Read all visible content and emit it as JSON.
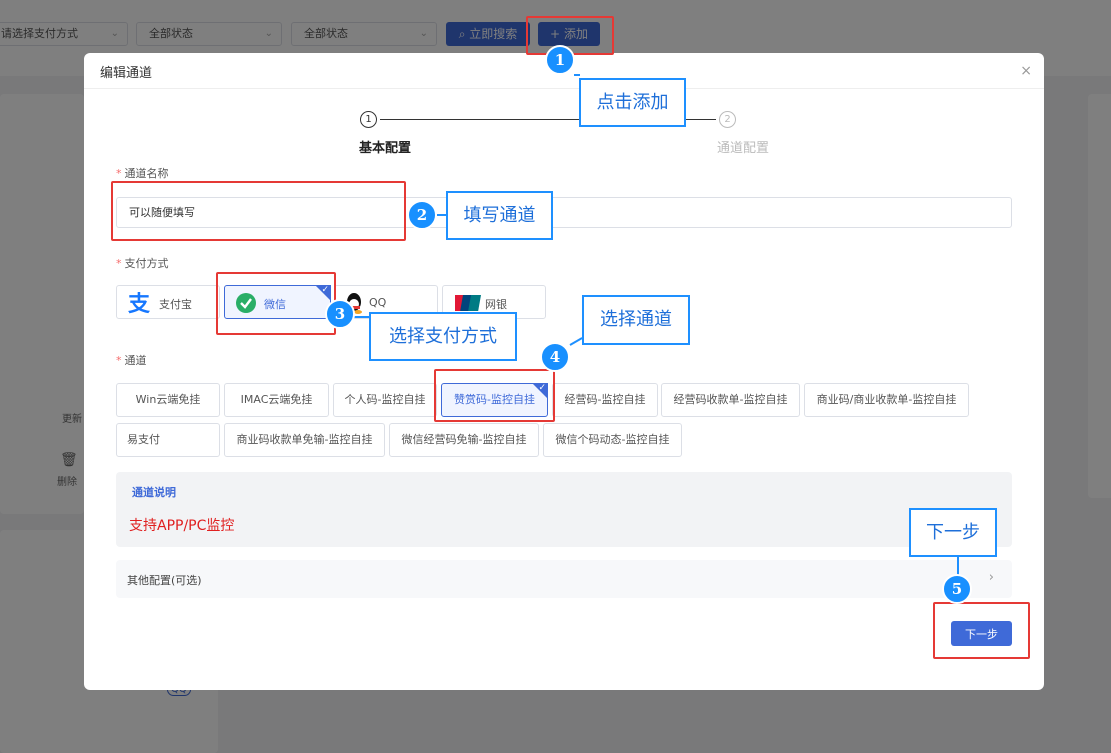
{
  "background": {
    "filters": [
      {
        "value": "请选择支付方式"
      },
      {
        "value": "全部状态"
      },
      {
        "value": "全部状态"
      }
    ],
    "search_label": "立即搜索",
    "add_label": "添加",
    "update_label": "更新",
    "delete_label": "删除",
    "qq_badge": "QQ"
  },
  "modal": {
    "title": "编辑通道",
    "close_icon": "×",
    "steps": [
      {
        "num": "1",
        "label": "基本配置"
      },
      {
        "num": "2",
        "label": "通道配置"
      }
    ],
    "name_field": {
      "required": "*",
      "label": "通道名称",
      "value": "可以随便填写"
    },
    "payment": {
      "required": "*",
      "label": "支付方式",
      "options": [
        {
          "label": "支付宝",
          "icon": "alipay-icon"
        },
        {
          "label": "微信",
          "icon": "wechat-icon",
          "selected": true
        },
        {
          "label": "QQ",
          "icon": "qq-icon"
        },
        {
          "label": "网银",
          "icon": "unionpay-icon"
        }
      ]
    },
    "channel": {
      "required": "*",
      "label": "通道",
      "options": [
        {
          "label": "Win云端免挂"
        },
        {
          "label": "IMAC云端免挂"
        },
        {
          "label": "个人码-监控自挂"
        },
        {
          "label": "赞赏码-监控自挂",
          "selected": true
        },
        {
          "label": "经营码-监控自挂"
        },
        {
          "label": "经营码收款单-监控自挂"
        },
        {
          "label": "商业码/商业收款单-监控自挂"
        },
        {
          "label": "易支付"
        },
        {
          "label": "商业码收款单免输-监控自挂"
        },
        {
          "label": "微信经营码免输-监控自挂"
        },
        {
          "label": "微信个码动态-监控自挂"
        }
      ]
    },
    "description": {
      "title": "通道说明",
      "text": "支持APP/PC监控"
    },
    "other": {
      "label": "其他配置(可选)",
      "arrow": "›"
    },
    "next_label": "下一步"
  },
  "annotations": [
    {
      "num": "1",
      "text": "点击添加"
    },
    {
      "num": "2",
      "text": "填写通道"
    },
    {
      "num": "3",
      "text": "选择支付方式"
    },
    {
      "num": "4",
      "text": "选择通道"
    },
    {
      "num": "5",
      "text": "下一步"
    }
  ],
  "colors": {
    "primary": "#3f6ad8",
    "annotation_red": "#e53935",
    "annotation_blue": "#1e90ff",
    "description_red": "#e02020"
  }
}
